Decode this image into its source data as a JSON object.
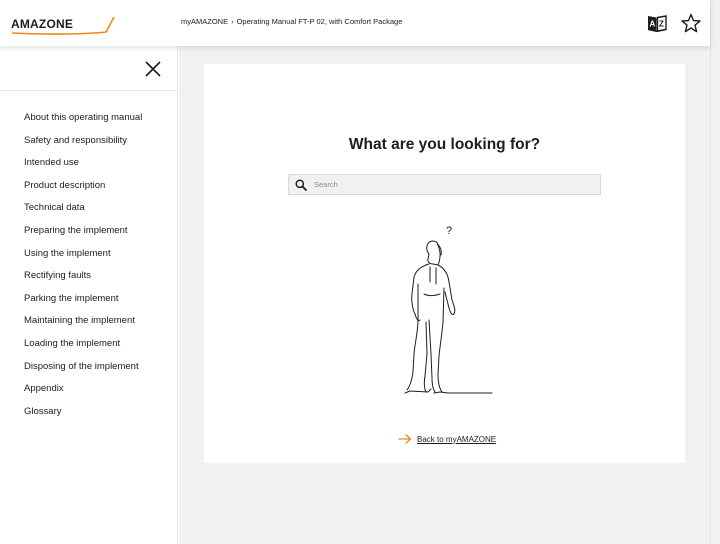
{
  "header": {
    "logo_text": "AMAZONE",
    "breadcrumb": [
      "myAMAZONE",
      "Operating Manual FT-P 02, with Comfort Package"
    ],
    "breadcrumb_separator": "›",
    "icons": [
      "dictionary-icon",
      "star-icon"
    ]
  },
  "sidebar": {
    "close_icon": "close-icon",
    "items": [
      {
        "label": "About this operating manual"
      },
      {
        "label": "Safety and responsibility"
      },
      {
        "label": "Intended use"
      },
      {
        "label": "Product description"
      },
      {
        "label": "Technical data"
      },
      {
        "label": "Preparing the implement"
      },
      {
        "label": "Using the implement"
      },
      {
        "label": "Rectifying faults"
      },
      {
        "label": "Parking the implement"
      },
      {
        "label": "Maintaining the implement"
      },
      {
        "label": "Loading the implement"
      },
      {
        "label": "Disposing of the implement"
      },
      {
        "label": "Appendix"
      },
      {
        "label": "Glossary"
      }
    ]
  },
  "main": {
    "heading": "What are you looking for?",
    "search": {
      "placeholder": "Search",
      "value": ""
    },
    "back_link": "Back to myAMAZONE"
  },
  "colors": {
    "accent": "#e8891a",
    "text": "#1d1d1b",
    "panel_bg": "#f1f1f1"
  }
}
